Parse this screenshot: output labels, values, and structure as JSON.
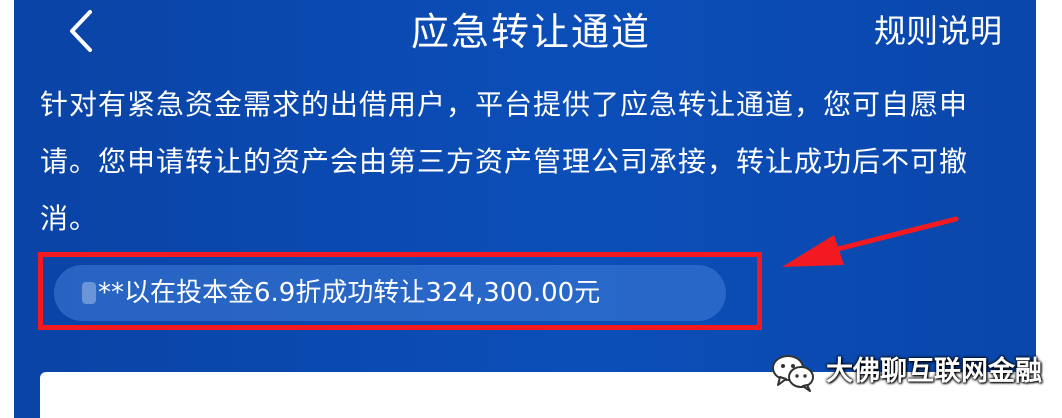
{
  "header": {
    "title": "应急转让通道",
    "rules_label": "规则说明",
    "back_icon": "chevron-left-icon"
  },
  "description": "针对有紧急资金需求的出借用户，平台提供了应急转让通道，您可自愿申请。您申请转让的资产会由第三方资产管理公司承接，转让成功后不可撤消。",
  "ticker": {
    "masked_user": "**",
    "message": "以在投本金6.9折成功转让324,300.00元"
  },
  "watermark": {
    "text": "大佛聊互联网金融",
    "icon": "wechat-icon"
  },
  "colors": {
    "background": "#0b4aaf",
    "highlight_border": "#f21a20",
    "arrow": "#f21a20",
    "text": "#ffffff"
  }
}
